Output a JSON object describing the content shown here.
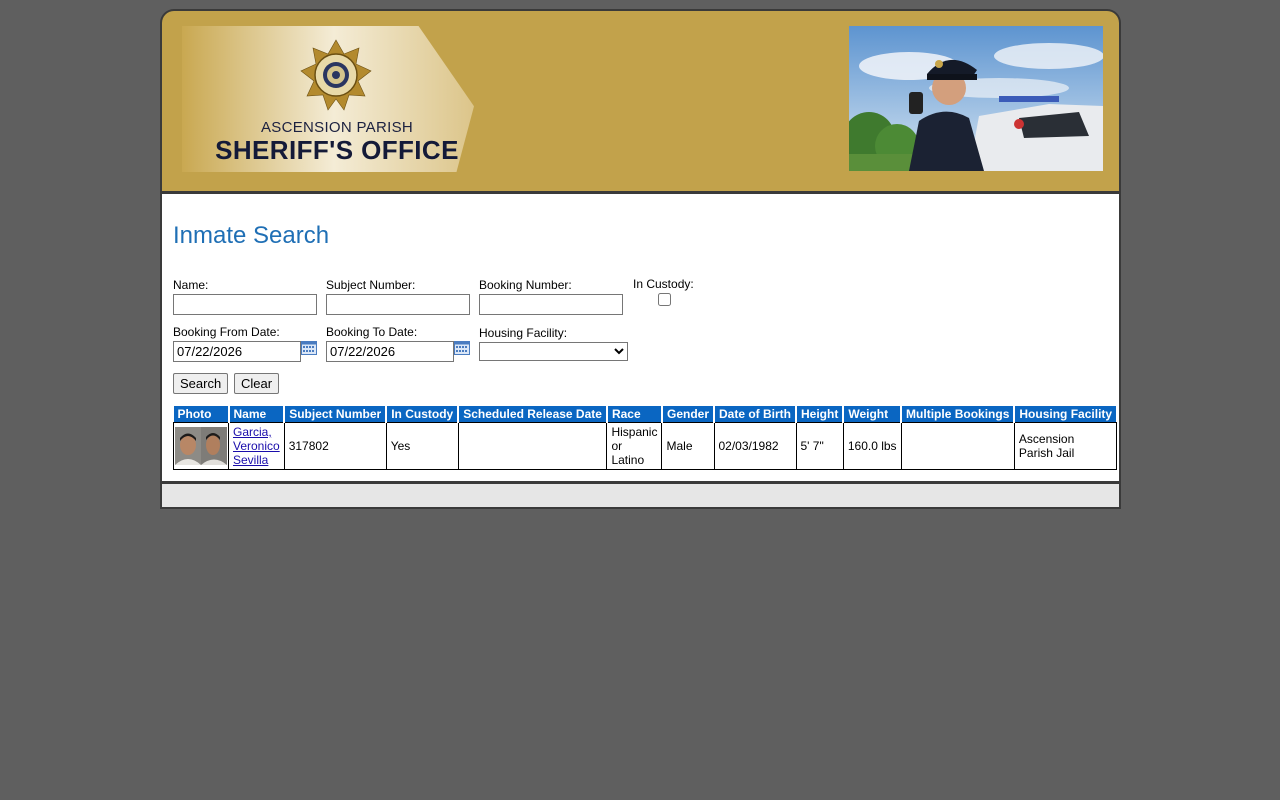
{
  "header": {
    "logo_line1": "ASCENSION PARISH",
    "logo_line2": "SHERIFF'S OFFICE"
  },
  "page_title": "Inmate Search",
  "form": {
    "name_label": "Name:",
    "name_value": "",
    "subject_label": "Subject Number:",
    "subject_value": "",
    "booking_label": "Booking Number:",
    "booking_value": "",
    "custody_label": "In Custody:",
    "from_label": "Booking From Date:",
    "from_value": "07/22/2026",
    "to_label": "Booking To Date:",
    "to_value": "07/22/2026",
    "housing_label": "Housing Facility:",
    "housing_value": "",
    "search_label": "Search",
    "clear_label": "Clear"
  },
  "table": {
    "headers": [
      "Photo",
      "Name",
      "Subject Number",
      "In Custody",
      "Scheduled Release Date",
      "Race",
      "Gender",
      "Date of Birth",
      "Height",
      "Weight",
      "Multiple Bookings",
      "Housing Facility"
    ],
    "rows": [
      {
        "name": "Garcia, Veronico Sevilla",
        "subject_number": "317802",
        "in_custody": "Yes",
        "scheduled_release": "",
        "race": "Hispanic or Latino",
        "gender": "Male",
        "dob": "02/03/1982",
        "height": "5' 7\"",
        "weight": "160.0 lbs",
        "multiple_bookings": "",
        "housing_facility": "Ascension Parish Jail"
      }
    ]
  },
  "colors": {
    "header_gold": "#c2a24b",
    "title_blue": "#1f6fb5",
    "table_header_blue": "#0a66c2"
  }
}
